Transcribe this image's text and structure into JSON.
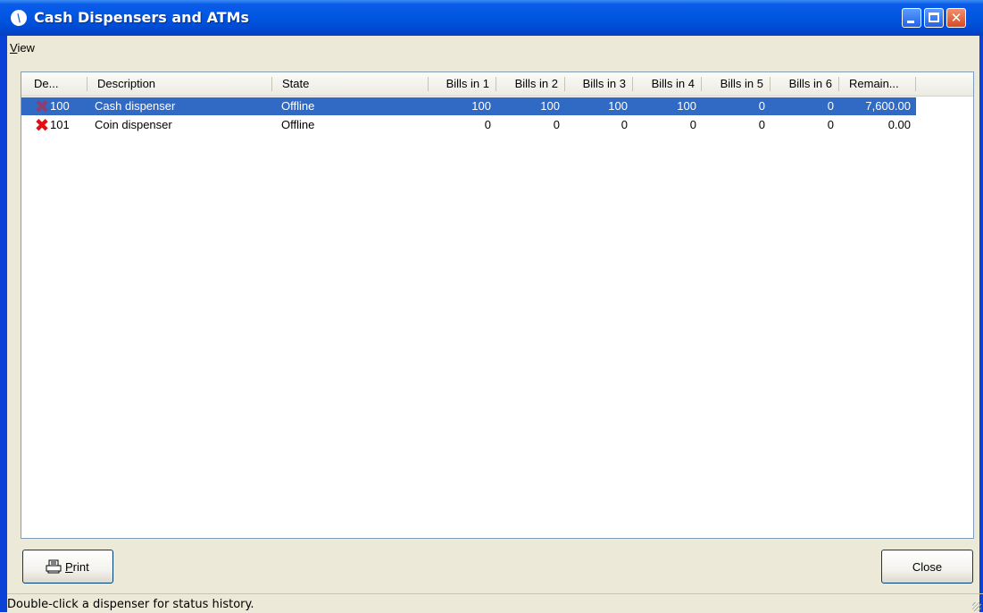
{
  "window": {
    "title": "Cash Dispensers and ATMs"
  },
  "menu": {
    "view_label": "View"
  },
  "table": {
    "columns": [
      {
        "label": "De..."
      },
      {
        "label": "Description"
      },
      {
        "label": "State"
      },
      {
        "label": "Bills in 1"
      },
      {
        "label": "Bills in 2"
      },
      {
        "label": "Bills in 3"
      },
      {
        "label": "Bills in 4"
      },
      {
        "label": "Bills in 5"
      },
      {
        "label": "Bills in 6"
      },
      {
        "label": "Remain..."
      }
    ],
    "rows": [
      {
        "status_icon": "offline-x-icon",
        "id": "100",
        "description": "Cash dispenser",
        "state": "Offline",
        "bills": [
          "100",
          "100",
          "100",
          "100",
          "0",
          "0"
        ],
        "remaining": "7,600.00",
        "selected": true
      },
      {
        "status_icon": "offline-x-icon",
        "id": "101",
        "description": "Coin dispenser",
        "state": "Offline",
        "bills": [
          "0",
          "0",
          "0",
          "0",
          "0",
          "0"
        ],
        "remaining": "0.00",
        "selected": false
      }
    ]
  },
  "buttons": {
    "print_label": "Print",
    "close_label": "Close"
  },
  "status": {
    "text": "Double-click a dispenser for status history."
  },
  "colors": {
    "selection": "#316ac5",
    "titlebar": "#0054e3",
    "offline_icon": "#e01010"
  }
}
